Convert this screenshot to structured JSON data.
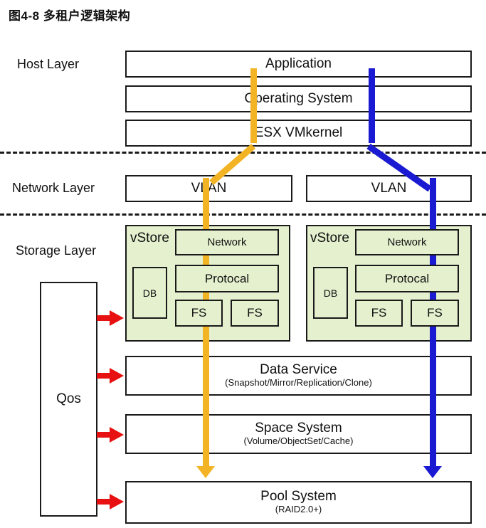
{
  "figure": {
    "caption": "图4-8  多租户逻辑架构"
  },
  "layers": [
    {
      "name": "host",
      "label": "Host Layer"
    },
    {
      "name": "network",
      "label": "Network  Layer"
    },
    {
      "name": "storage",
      "label": "Storage Layer"
    }
  ],
  "host_layer": {
    "boxes": [
      {
        "label": "Application"
      },
      {
        "label": "Operating System"
      },
      {
        "label": "ESX VMkernel"
      }
    ]
  },
  "network_layer": {
    "boxes": [
      {
        "label": "VLAN"
      },
      {
        "label": "VLAN"
      }
    ]
  },
  "storage_layer": {
    "qos": {
      "label": "Qos"
    },
    "vstores": [
      {
        "label": "vStore",
        "network": "Network",
        "db": "DB",
        "protocol": "Protocal",
        "fs": [
          "FS",
          "FS"
        ]
      },
      {
        "label": "vStore",
        "network": "Network",
        "db": "DB",
        "protocol": "Protocal",
        "fs": [
          "FS",
          "FS"
        ]
      }
    ],
    "stack": [
      {
        "title": "Data Service",
        "sub": "(Snapshot/Mirror/Replication/Clone)"
      },
      {
        "title": "Space System",
        "sub": "(Volume/ObjectSet/Cache)"
      },
      {
        "title": "Pool System",
        "sub": "(RAID2.0+)"
      }
    ]
  },
  "colors": {
    "tenant_a_flow": "#f2b424",
    "tenant_b_flow": "#1a1ad2",
    "qos_arrow": "#e81111",
    "vstore_fill": "#e4f0ce",
    "box_border": "#1a1a1a"
  }
}
